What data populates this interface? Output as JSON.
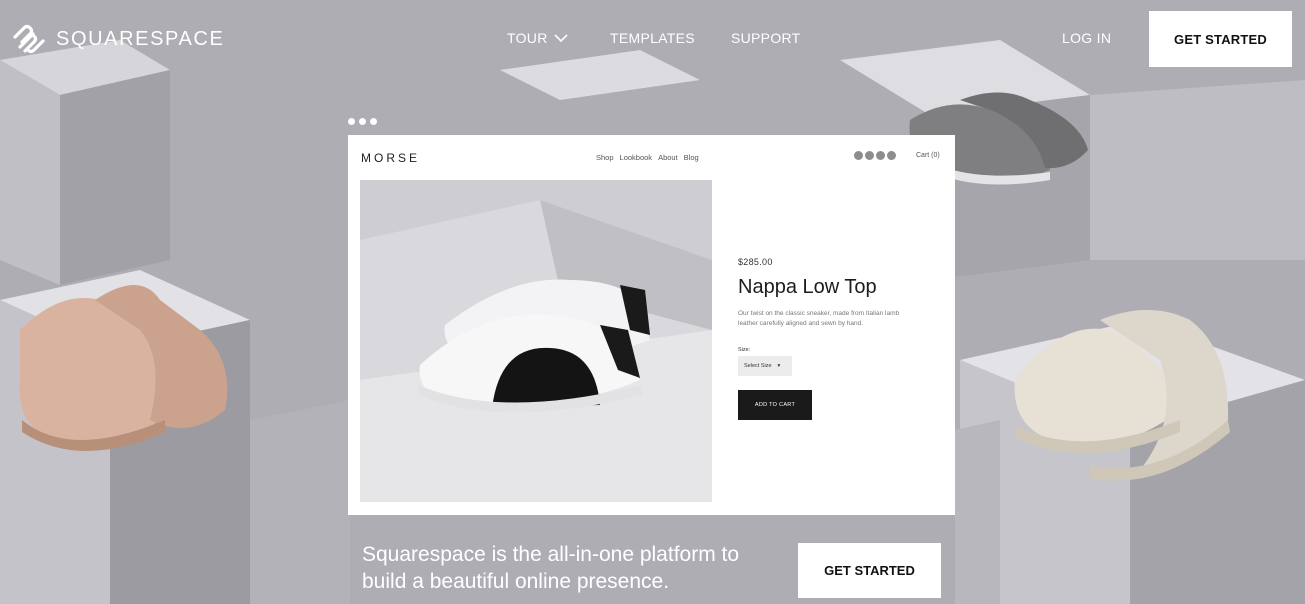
{
  "nav": {
    "brand": "SQUARESPACE",
    "brand_icon": "squarespace-logo-icon",
    "tour": "TOUR",
    "templates": "TEMPLATES",
    "support": "SUPPORT",
    "login": "LOG IN",
    "get_started": "GET STARTED"
  },
  "mockup": {
    "logo": "MORSE",
    "nav_items": [
      "Shop",
      "Lookbook",
      "About",
      "Blog"
    ],
    "social_icons": [
      "email-icon",
      "twitter-icon",
      "facebook-icon",
      "instagram-icon"
    ],
    "cart": "Cart (0)",
    "price": "$285.00",
    "title": "Nappa Low Top",
    "description": "Our twist on the classic sneaker, made from Italian lamb leather carefully aligned and sewn by hand.",
    "size_label": "Size:",
    "size_select": "Select Size",
    "add_to_cart": "ADD TO CART"
  },
  "hero": {
    "tagline": "Squarespace is the all-in-one platform to build a beautiful online presence.",
    "get_started": "GET STARTED"
  }
}
